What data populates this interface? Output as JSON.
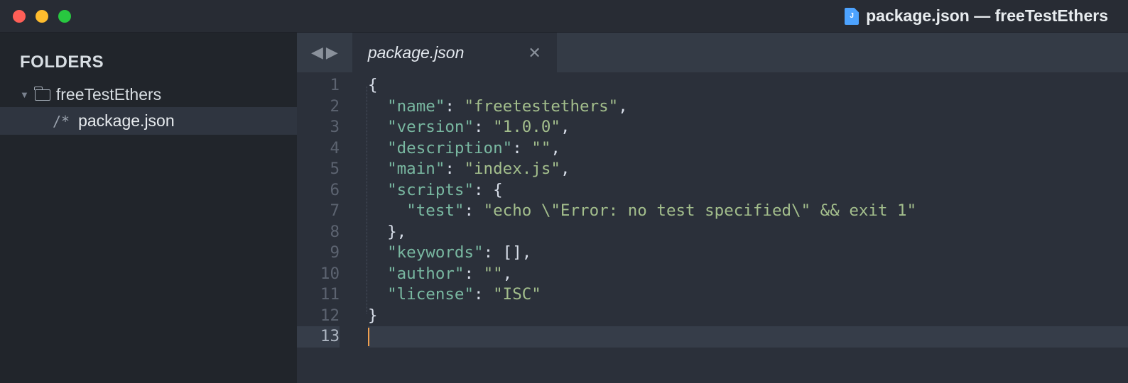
{
  "window": {
    "title": "package.json — freeTestEthers",
    "file_icon_letter": "J"
  },
  "sidebar": {
    "heading": "FOLDERS",
    "folder_name": "freeTestEthers",
    "file_marker": "/*",
    "file_name": "package.json"
  },
  "tabs": {
    "active": "package.json"
  },
  "editor": {
    "line_numbers": [
      "1",
      "2",
      "3",
      "4",
      "5",
      "6",
      "7",
      "8",
      "9",
      "10",
      "11",
      "12",
      "13"
    ],
    "active_line_index": 12,
    "lines": [
      [
        {
          "c": "p",
          "t": "{"
        }
      ],
      [
        {
          "c": "p",
          "t": "  "
        },
        {
          "c": "k",
          "t": "\"name\""
        },
        {
          "c": "p",
          "t": ": "
        },
        {
          "c": "s",
          "t": "\"freetestethers\""
        },
        {
          "c": "p",
          "t": ","
        }
      ],
      [
        {
          "c": "p",
          "t": "  "
        },
        {
          "c": "k",
          "t": "\"version\""
        },
        {
          "c": "p",
          "t": ": "
        },
        {
          "c": "s",
          "t": "\"1.0.0\""
        },
        {
          "c": "p",
          "t": ","
        }
      ],
      [
        {
          "c": "p",
          "t": "  "
        },
        {
          "c": "k",
          "t": "\"description\""
        },
        {
          "c": "p",
          "t": ": "
        },
        {
          "c": "s",
          "t": "\"\""
        },
        {
          "c": "p",
          "t": ","
        }
      ],
      [
        {
          "c": "p",
          "t": "  "
        },
        {
          "c": "k",
          "t": "\"main\""
        },
        {
          "c": "p",
          "t": ": "
        },
        {
          "c": "s",
          "t": "\"index.js\""
        },
        {
          "c": "p",
          "t": ","
        }
      ],
      [
        {
          "c": "p",
          "t": "  "
        },
        {
          "c": "k",
          "t": "\"scripts\""
        },
        {
          "c": "p",
          "t": ": {"
        }
      ],
      [
        {
          "c": "p",
          "t": "    "
        },
        {
          "c": "k",
          "t": "\"test\""
        },
        {
          "c": "p",
          "t": ": "
        },
        {
          "c": "s",
          "t": "\"echo \\\"Error: no test specified\\\" && exit 1\""
        }
      ],
      [
        {
          "c": "p",
          "t": "  },"
        }
      ],
      [
        {
          "c": "p",
          "t": "  "
        },
        {
          "c": "k",
          "t": "\"keywords\""
        },
        {
          "c": "p",
          "t": ": [],"
        }
      ],
      [
        {
          "c": "p",
          "t": "  "
        },
        {
          "c": "k",
          "t": "\"author\""
        },
        {
          "c": "p",
          "t": ": "
        },
        {
          "c": "s",
          "t": "\"\""
        },
        {
          "c": "p",
          "t": ","
        }
      ],
      [
        {
          "c": "p",
          "t": "  "
        },
        {
          "c": "k",
          "t": "\"license\""
        },
        {
          "c": "p",
          "t": ": "
        },
        {
          "c": "s",
          "t": "\"ISC\""
        }
      ],
      [
        {
          "c": "p",
          "t": "}"
        }
      ],
      []
    ]
  }
}
